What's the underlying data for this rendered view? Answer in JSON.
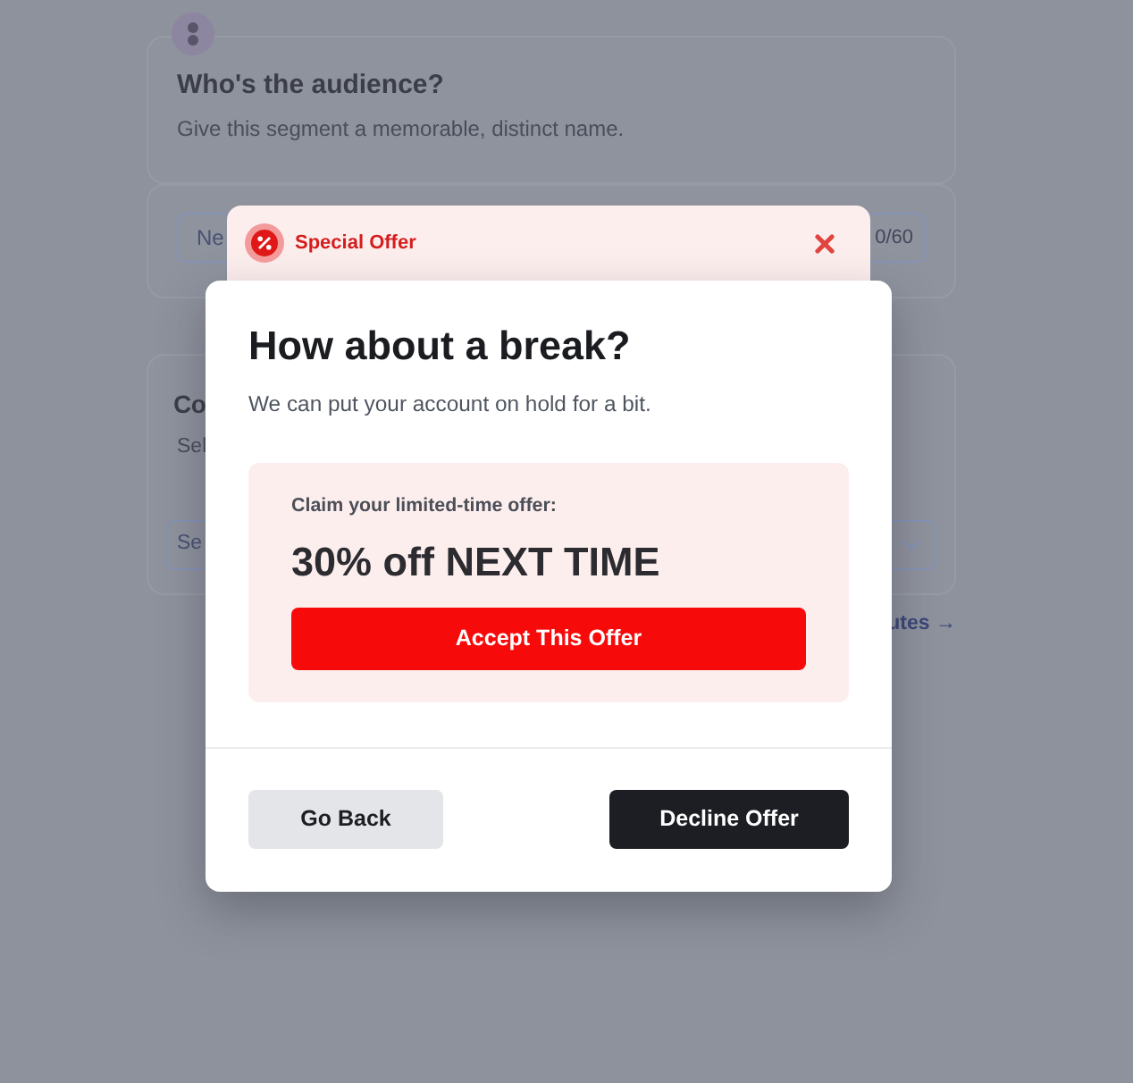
{
  "background_page": {
    "audience_card": {
      "title": "Who's the audience?",
      "subtitle": "Give this segment a memorable, distinct name."
    },
    "name_field": {
      "placeholder": "Ne",
      "counter": "0/60"
    },
    "second_card": {
      "title": "Co",
      "subtitle": "Sel",
      "select": {
        "placeholder": "Se"
      }
    },
    "link": "utes →"
  },
  "offer_banner": {
    "label": "Special Offer"
  },
  "modal": {
    "title": "How about a break?",
    "description": "We can put your account on hold for a bit.",
    "offer": {
      "intro": "Claim your limited-time offer:",
      "headline": "30% off NEXT TIME",
      "accept_button": "Accept This Offer"
    },
    "buttons": [
      {
        "label": "Go Back",
        "kind": "secondary"
      },
      {
        "label": "Decline Offer",
        "kind": "primary"
      }
    ]
  }
}
